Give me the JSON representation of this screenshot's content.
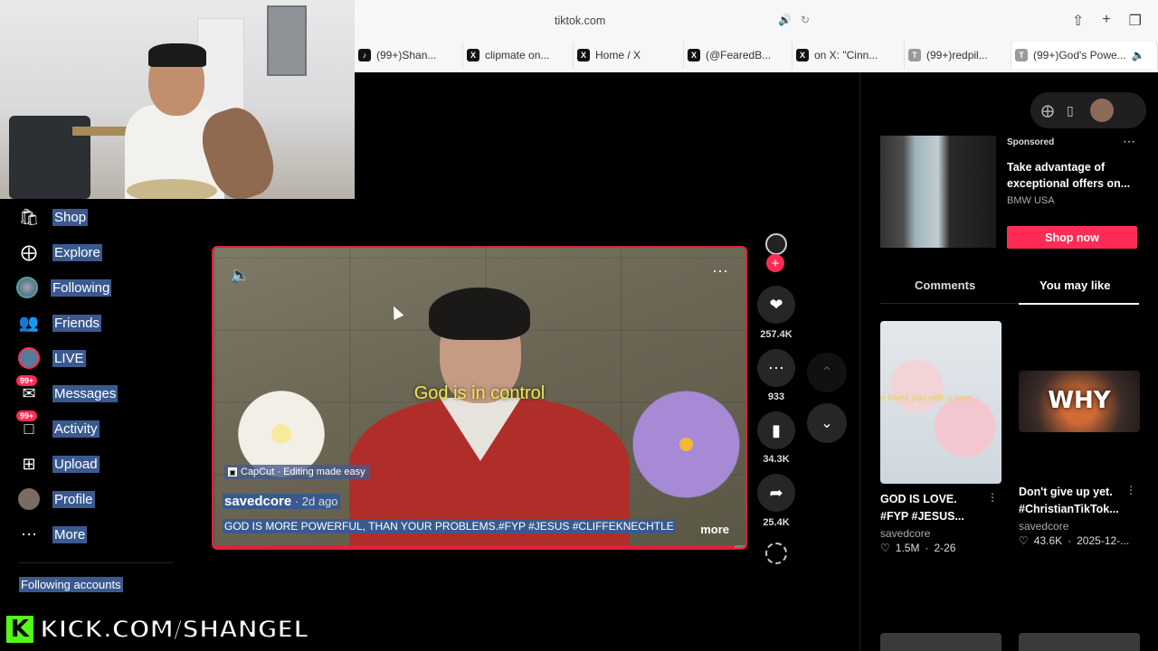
{
  "browser": {
    "url": "tiktok.com",
    "tabs": [
      {
        "icon": "tiktok-icon",
        "fav": "♪",
        "label": "(99+)Shan..."
      },
      {
        "icon": "x-icon",
        "fav": "X",
        "label": "clipmate on..."
      },
      {
        "icon": "x-icon",
        "fav": "X",
        "label": "Home / X"
      },
      {
        "icon": "x-icon",
        "fav": "X",
        "label": "(@FearedB..."
      },
      {
        "icon": "x-icon",
        "fav": "X",
        "label": "on X: \"Cinn..."
      },
      {
        "icon": "t-icon",
        "fav": "T",
        "label": "(99+)redpil..."
      },
      {
        "icon": "t-icon",
        "fav": "T",
        "label": "(99+)God's Powe..."
      }
    ]
  },
  "nav": {
    "items": [
      {
        "label": "Shop",
        "icon": "shopping-bag-icon"
      },
      {
        "label": "Explore",
        "icon": "compass-icon"
      },
      {
        "label": "Following",
        "icon": "following-avatar-icon"
      },
      {
        "label": "Friends",
        "icon": "friends-icon"
      },
      {
        "label": "LIVE",
        "icon": "live-icon"
      },
      {
        "label": "Messages",
        "icon": "messages-icon",
        "badge": "99+"
      },
      {
        "label": "Activity",
        "icon": "activity-icon",
        "badge": "99+"
      },
      {
        "label": "Upload",
        "icon": "upload-icon"
      },
      {
        "label": "Profile",
        "icon": "profile-avatar-icon"
      },
      {
        "label": "More",
        "icon": "more-icon"
      }
    ],
    "following_accounts": "Following accounts"
  },
  "watermark": {
    "logo": "K",
    "text": "KICK.COM/SHANGEL"
  },
  "video": {
    "caption": "God is in control",
    "capcut": "CapCut · Editing made easy",
    "author": "savedcore",
    "age": " · 2d ago",
    "description": "GOD IS MORE POWERFUL, THAN YOUR PROBLEMS.#FYP #JESUS #CLIFFEKNECHTLE",
    "more": "more",
    "progress": 0.98
  },
  "actions": {
    "plus": "+",
    "likes": "257.4K",
    "comments": "933",
    "saves": "34.3K",
    "shares": "25.4K"
  },
  "ad": {
    "sponsored": "Sponsored",
    "title": "Take advantage of exceptional offers on...",
    "brand": "BMW USA",
    "cta": "Shop now"
  },
  "tabs_right": {
    "comments": "Comments",
    "you_may_like": "You may like"
  },
  "recommendations": [
    {
      "thumb_text": "e loves you with a love",
      "title": "GOD IS LOVE. #FYP #JESUS...",
      "author": "savedcore",
      "likes": "1.5M",
      "date": "2-26"
    },
    {
      "thumb_text": "WHY",
      "title": "Don't give up yet. #ChristianTikTok...",
      "author": "savedcore",
      "likes": "43.6K",
      "date": "2025-12-..."
    }
  ],
  "colors": {
    "accent": "#fe2c55",
    "highlight": "#3a5a8f",
    "kick": "#53fc18",
    "caption": "#f2e84b"
  }
}
